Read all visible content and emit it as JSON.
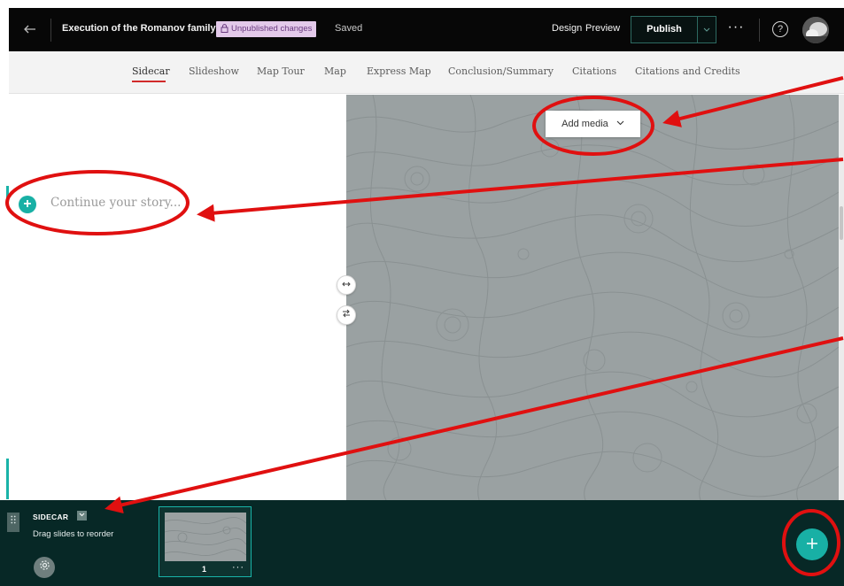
{
  "topbar": {
    "back_icon": "arrow-left-icon",
    "title": "Execution of the Romanov family",
    "badge": "Unpublished changes",
    "saved": "Saved",
    "design": "Design",
    "preview": "Preview",
    "publish": "Publish",
    "more_glyph": "···",
    "help_glyph": "?"
  },
  "nav": {
    "tabs": [
      "Sidecar",
      "Slideshow",
      "Map Tour",
      "Map",
      "Express Map",
      "Conclusion/Summary",
      "Citations",
      "Citations and Credits"
    ],
    "active_tab": "Sidecar"
  },
  "left": {
    "placeholder": "Continue your story..."
  },
  "media": {
    "add_media": "Add media"
  },
  "bottom": {
    "label": "SIDECAR",
    "hint": "Drag slides to reorder",
    "slide_number": "1",
    "slide_more": "···"
  },
  "colors": {
    "accent_teal": "#18b0a5",
    "bottom_bar": "#072826",
    "media_bg": "#9aa1a2",
    "annotation_red": "#e01010"
  }
}
